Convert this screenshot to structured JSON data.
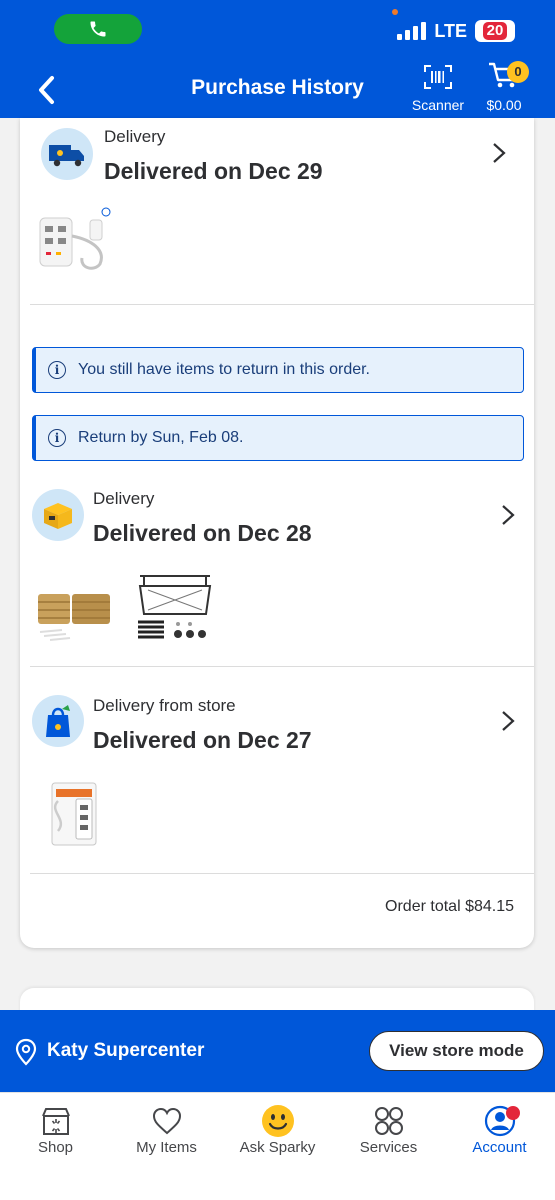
{
  "status_bar": {
    "network": "LTE",
    "battery": "20"
  },
  "header": {
    "title": "Purchase History",
    "scanner_label": "Scanner",
    "cart_count": "0",
    "cart_total": "$0.00"
  },
  "shipments": [
    {
      "type": "Delivery",
      "status": "Delivered on Dec 29"
    },
    {
      "type": "Delivery",
      "status": "Delivered on Dec 28"
    },
    {
      "type": "Delivery from store",
      "status": "Delivered on Dec 27"
    }
  ],
  "notices": [
    "You still have items to return in this order.",
    "Return by Sun, Feb 08."
  ],
  "order_total": "Order total $84.15",
  "store_bar": {
    "store_name": "Katy Supercenter",
    "button_label": "View store mode"
  },
  "bottom_nav": [
    {
      "label": "Shop",
      "icon": "store-icon"
    },
    {
      "label": "My Items",
      "icon": "heart-icon"
    },
    {
      "label": "Ask Sparky",
      "icon": "sparky-smiley-icon"
    },
    {
      "label": "Services",
      "icon": "services-grid-icon"
    },
    {
      "label": "Account",
      "icon": "account-icon",
      "active": true
    }
  ],
  "colors": {
    "brand_blue": "#0057d9",
    "spark_yellow": "#ffc220",
    "call_green": "#14a33a",
    "alert_red": "#e3263a"
  }
}
